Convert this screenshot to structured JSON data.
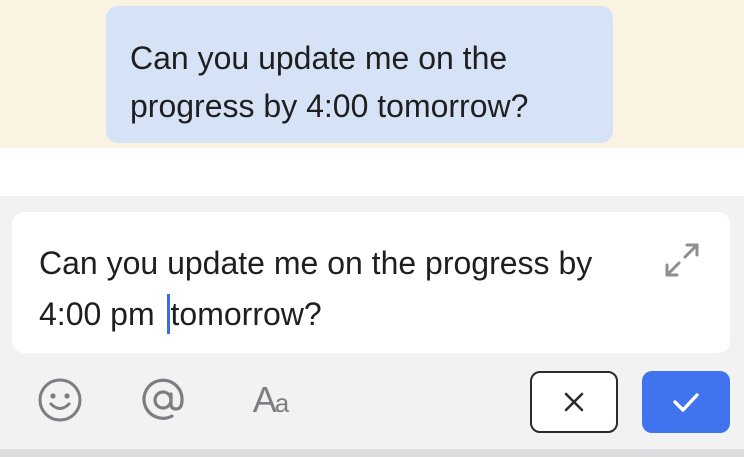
{
  "chat": {
    "message_text": "Can you update me on the progress by 4:00 tomorrow?"
  },
  "composer": {
    "text_before_caret": "Can you update me on the progress by 4:00 pm ",
    "text_after_caret": "tomorrow?",
    "icons": {
      "expand": "expand-icon",
      "emoji": "emoji-icon",
      "mention": "at-sign-icon",
      "format": "text-format-icon",
      "cancel": "close-icon",
      "confirm": "checkmark-icon"
    },
    "format_label_big": "A",
    "format_label_small": "a"
  },
  "colors": {
    "chat_background": "#fbf3e1",
    "bubble": "#d6e3f7",
    "caret": "#3b6fe0",
    "confirm_button": "#3f74ee",
    "icon_gray": "#7d7d82"
  }
}
